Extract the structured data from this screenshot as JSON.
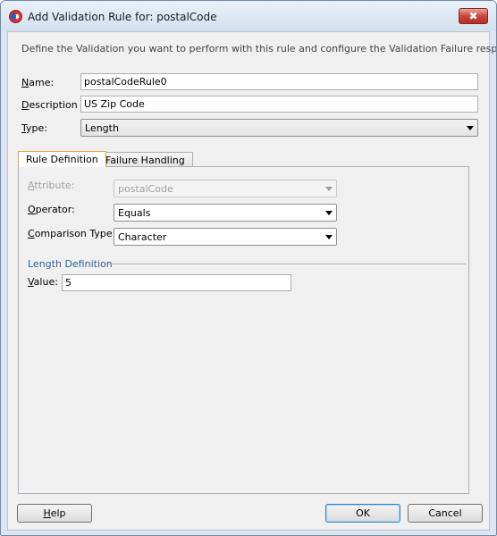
{
  "window": {
    "title": "Add Validation Rule for: postalCode",
    "close_glyph": "✖",
    "icon": "oracle-jdeveloper-icon"
  },
  "intro_text": "Define the Validation you want to perform with this rule and configure the Validation Failure response.",
  "form": {
    "name_label_mn": "N",
    "name_label_rest": "ame:",
    "name_value": "postalCodeRule0",
    "description_label_mn": "D",
    "description_label_rest": "escription",
    "description_value": "US Zip Code",
    "type_label_mn": "T",
    "type_label_rest": "ype:",
    "type_value": "Length"
  },
  "tabs": [
    {
      "label": "Rule Definition",
      "active": true
    },
    {
      "label": "Failure Handling",
      "active": false
    }
  ],
  "rule_definition": {
    "attribute_label_mn": "A",
    "attribute_label_rest": "ttribute:",
    "attribute_value": "postalCode",
    "operator_label_mn": "O",
    "operator_label_rest": "perator:",
    "operator_value": "Equals",
    "comparison_label_mn": "C",
    "comparison_label_rest": "omparison Type:",
    "comparison_value": "Character",
    "length_group_label": "Length Definition",
    "value_label_mn": "V",
    "value_label_rest": "alue:",
    "value_value": "5"
  },
  "buttons": {
    "help_mn": "H",
    "help_rest": "elp",
    "ok": "OK",
    "cancel": "Cancel"
  },
  "colors": {
    "title_bar": "#d3e0ee",
    "close_button": "#c9463a",
    "active_tab_border": "#e8a33a",
    "group_label": "#2d5fa0"
  }
}
